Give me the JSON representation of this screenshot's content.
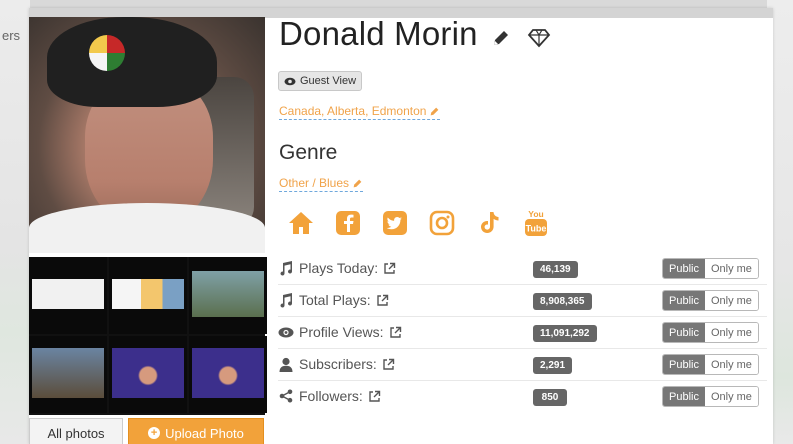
{
  "background": {
    "left_text": "ers"
  },
  "profile": {
    "name": "Donald Morin",
    "guest_view_label": "Guest View",
    "location": "Canada, Alberta, Edmonton",
    "genre_heading": "Genre",
    "genre": "Other / Blues"
  },
  "photos": {
    "all_photos_label": "All photos",
    "upload_label": "Upload Photo"
  },
  "social_icons": [
    "home-icon",
    "facebook-icon",
    "twitter-icon",
    "instagram-icon",
    "tiktok-icon",
    "youtube-icon"
  ],
  "stats": [
    {
      "label": "Plays Today:",
      "icon": "music-note-icon",
      "value": "46,139",
      "public": "Public",
      "only_me": "Only me"
    },
    {
      "label": "Total Plays:",
      "icon": "music-note-icon",
      "value": "8,908,365",
      "public": "Public",
      "only_me": "Only me"
    },
    {
      "label": "Profile Views:",
      "icon": "eye-icon",
      "value": "11,091,292",
      "public": "Public",
      "only_me": "Only me"
    },
    {
      "label": "Subscribers:",
      "icon": "user-icon",
      "value": "2,291",
      "public": "Public",
      "only_me": "Only me"
    },
    {
      "label": "Followers:",
      "icon": "share-icon",
      "value": "850",
      "public": "Public",
      "only_me": "Only me"
    }
  ],
  "colors": {
    "accent": "#f2a23a",
    "link": "#f0a34a",
    "badge": "#666666"
  }
}
